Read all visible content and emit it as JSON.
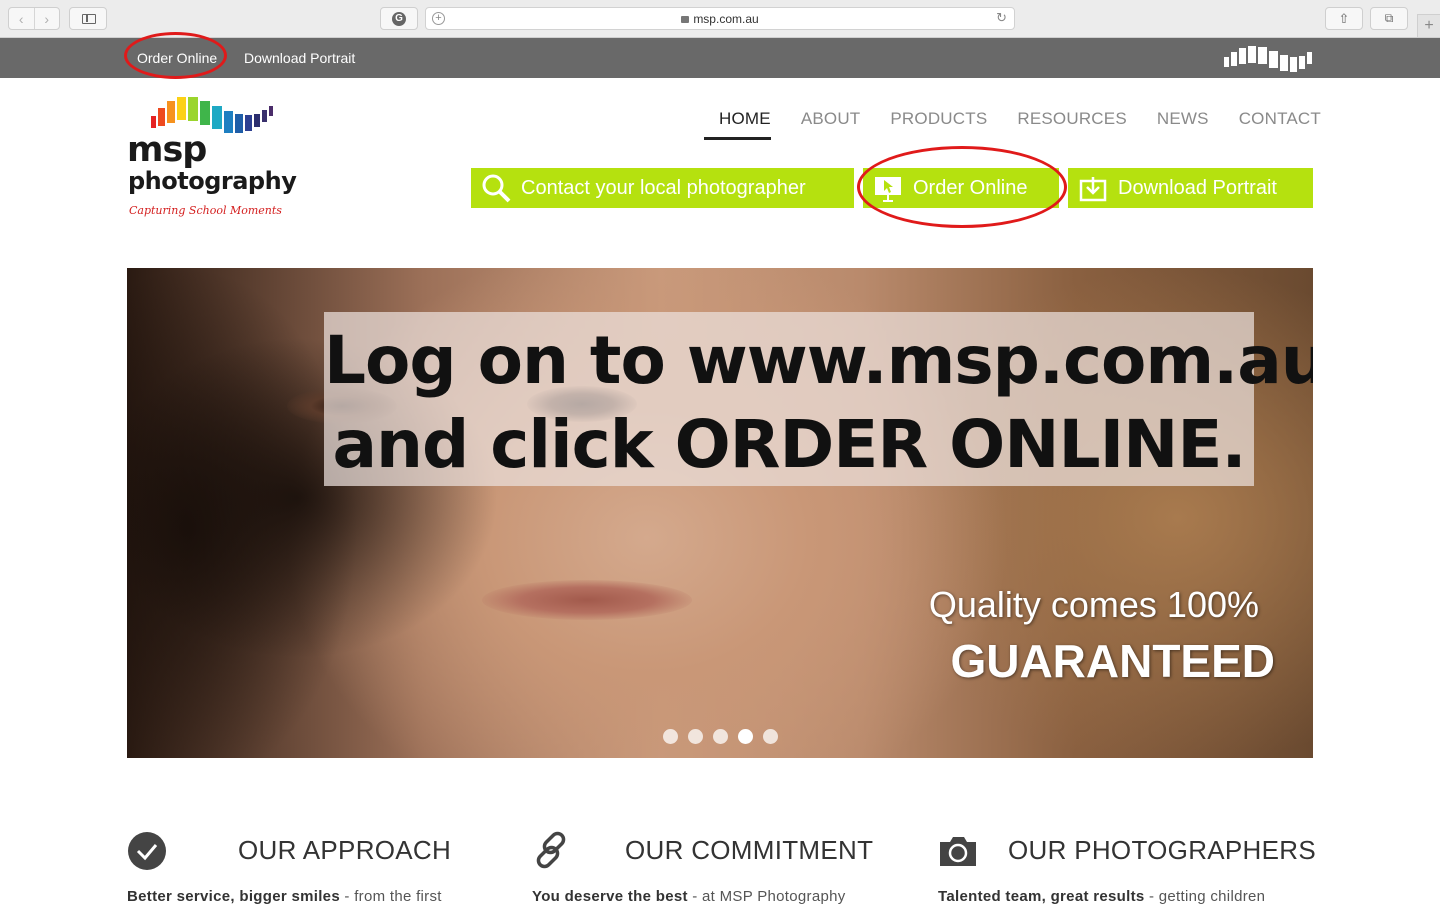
{
  "browser": {
    "url": "msp.com.au",
    "back_icon": "chevron-left-icon",
    "forward_icon": "chevron-right-icon",
    "new_tab_symbol": "+"
  },
  "topbar": {
    "order_online": "Order Online",
    "download_portrait": "Download Portrait"
  },
  "logo": {
    "line1": "msp",
    "line2": "photography",
    "tagline": "Capturing School Moments"
  },
  "nav": {
    "items": [
      "HOME",
      "ABOUT",
      "PRODUCTS",
      "RESOURCES",
      "NEWS",
      "CONTACT"
    ],
    "active": "HOME"
  },
  "buttons": {
    "contact": "Contact your local photographer",
    "order": "Order Online",
    "download": "Download Portrait"
  },
  "hero": {
    "overlay_line1": "Log on to www.msp.com.au",
    "overlay_line2": "and click ORDER ONLINE.",
    "quality_line1": "Quality comes 100%",
    "quality_line2": "GUARANTEED",
    "slide_count": 5,
    "active_slide": 4
  },
  "sections": [
    {
      "title": "OUR APPROACH",
      "bold": "Better service, bigger smiles",
      "text": " - from the first",
      "icon": "checkmark-circle-icon"
    },
    {
      "title": "OUR COMMITMENT",
      "bold": "You deserve the best",
      "text": " - at MSP Photography",
      "icon": "link-icon"
    },
    {
      "title": "OUR PHOTOGRAPHERS",
      "bold": "Talented team, great results",
      "text": " - getting children",
      "icon": "camera-icon"
    }
  ],
  "colors": {
    "accent_green": "#b5e10f",
    "topbar_grey": "#696969",
    "highlight_red": "#e01a1a"
  }
}
